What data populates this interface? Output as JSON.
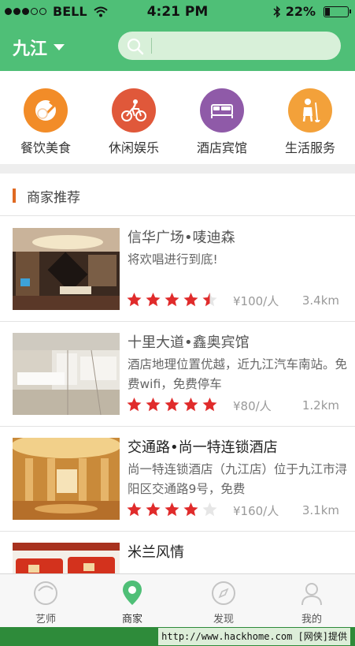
{
  "status_bar": {
    "carrier": "BELL",
    "time": "4:21 PM",
    "battery_text": "22%",
    "battery_level": 0.22
  },
  "header": {
    "city": "九江",
    "search_placeholder": ""
  },
  "categories": [
    {
      "label": "餐饮美食",
      "icon": "dining-icon",
      "color": "#f28c28"
    },
    {
      "label": "休闲娱乐",
      "icon": "bicycle-icon",
      "color": "#e0583a"
    },
    {
      "label": "酒店宾馆",
      "icon": "bed-icon",
      "color": "#8f5aa8"
    },
    {
      "label": "生活服务",
      "icon": "cleaning-icon",
      "color": "#f3a13a"
    }
  ],
  "section": {
    "title": "商家推荐"
  },
  "merchants": [
    {
      "name": "信华广场•唛迪森",
      "desc": "将欢唱进行到底!",
      "rating": 4.5,
      "price": "¥100/人",
      "distance": "3.4km"
    },
    {
      "name": "十里大道•鑫奥宾馆",
      "desc": "酒店地理位置优越，近九江汽车南站。免费wifi，免费停车",
      "rating": 5,
      "price": "¥80/人",
      "distance": "1.2km"
    },
    {
      "name": "交通路•尚一特连锁酒店",
      "desc": "尚一特连锁酒店（九江店）位于九江市浔阳区交通路9号，免费",
      "rating": 4,
      "price": "¥160/人",
      "distance": "3.1km"
    },
    {
      "name": "米兰风情",
      "desc": "",
      "rating": 0,
      "price": "",
      "distance": ""
    }
  ],
  "tabs": [
    {
      "label": "艺师",
      "icon": "artist-icon"
    },
    {
      "label": "商家",
      "icon": "location-pin-icon"
    },
    {
      "label": "发现",
      "icon": "compass-icon"
    },
    {
      "label": "我的",
      "icon": "user-icon"
    }
  ],
  "active_tab": 1,
  "colors": {
    "brand_green": "#4fbf77",
    "star_red": "#e02b2b",
    "section_accent": "#e06a22"
  },
  "watermark": "http://www.hackhome.com [网侠]提供"
}
